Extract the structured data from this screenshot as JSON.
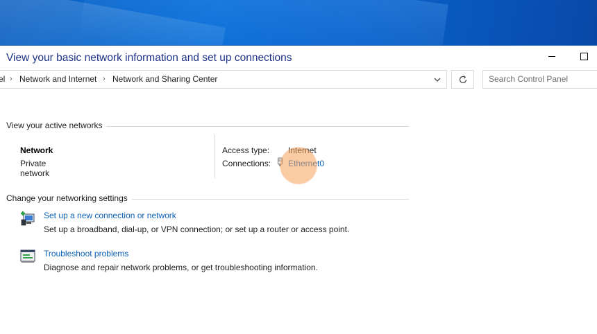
{
  "breadcrumb": {
    "items": [
      "el",
      "Network and Internet",
      "Network and Sharing Center"
    ]
  },
  "search": {
    "placeholder": "Search Control Panel"
  },
  "page": {
    "title": "View your basic network information and set up connections"
  },
  "active_networks": {
    "heading": "View your active networks",
    "network_name": "Network",
    "network_category": "Private network",
    "access_type_label": "Access type:",
    "access_type_value": "Internet",
    "connections_label": "Connections:",
    "connection_name": "Ethernet0"
  },
  "settings": {
    "heading": "Change your networking settings",
    "tasks": [
      {
        "link": "Set up a new connection or network",
        "description": "Set up a broadband, dial-up, or VPN connection; or set up a router or access point.",
        "icon": "new-connection-icon"
      },
      {
        "link": "Troubleshoot problems",
        "description": "Diagnose and repair network problems, or get troubleshooting information.",
        "icon": "troubleshoot-icon"
      }
    ]
  },
  "colors": {
    "title": "#1e3287",
    "link": "#0b61b8",
    "desktop": "#0a6fd8",
    "click_highlight": "#f7a05a"
  }
}
